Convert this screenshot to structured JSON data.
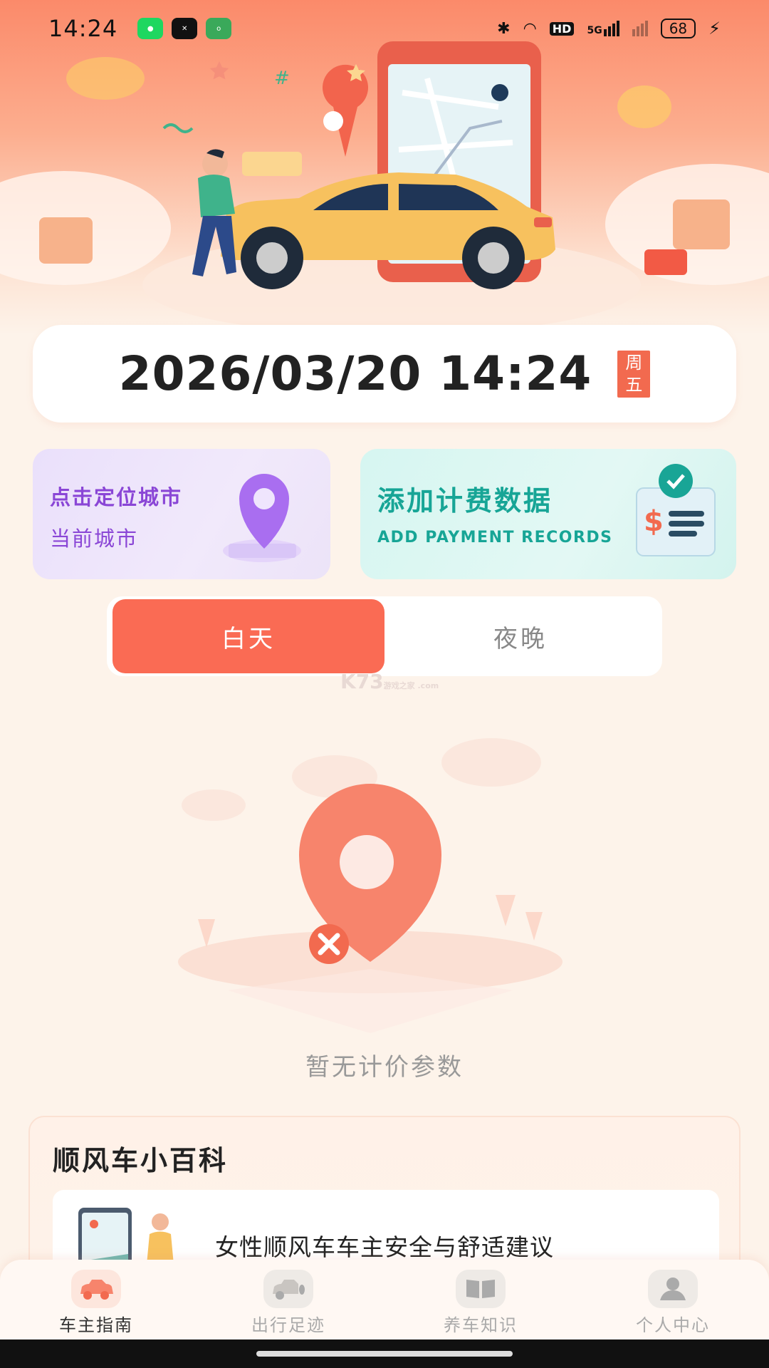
{
  "status_bar": {
    "time": "14:24",
    "battery": "68",
    "icons": [
      "wechat-icon",
      "capcut-icon",
      "oppo-icon",
      "bluetooth-icon",
      "wifi-icon",
      "hd-icon",
      "signal-5g-icon",
      "signal-icon",
      "charging-icon"
    ],
    "hd_label": "HD",
    "network_label": "5G"
  },
  "datetime": {
    "text": "2026/03/20 14:24",
    "weekday_line1": "周",
    "weekday_line2": "五"
  },
  "city_card": {
    "line1": "点击定位城市",
    "line2": "当前城市",
    "icon": "location-pin-icon"
  },
  "payment_card": {
    "title": "添加计费数据",
    "subtitle": "ADD PAYMENT RECORDS",
    "icon": "bill-check-icon"
  },
  "time_toggle": {
    "day_label": "白天",
    "night_label": "夜晚",
    "selected": "day"
  },
  "watermark": {
    "text": "K73",
    "small": "游戏之家 .com"
  },
  "empty_state": {
    "text": "暂无计价参数",
    "icon": "location-off-icon"
  },
  "wiki": {
    "title": "顺风车小百科",
    "items": [
      {
        "title": "女性顺风车车主安全与舒适建议"
      }
    ]
  },
  "tabbar": {
    "tabs": [
      {
        "label": "车主指南",
        "icon": "car-icon",
        "active": true
      },
      {
        "label": "出行足迹",
        "icon": "footprint-car-icon",
        "active": false
      },
      {
        "label": "养车知识",
        "icon": "book-icon",
        "active": false
      },
      {
        "label": "个人中心",
        "icon": "user-icon",
        "active": false
      }
    ]
  },
  "colors": {
    "accent": "#fa6b54",
    "city_text": "#8a46d6",
    "payment_text": "#17a596",
    "background": "#fdf3ea"
  }
}
